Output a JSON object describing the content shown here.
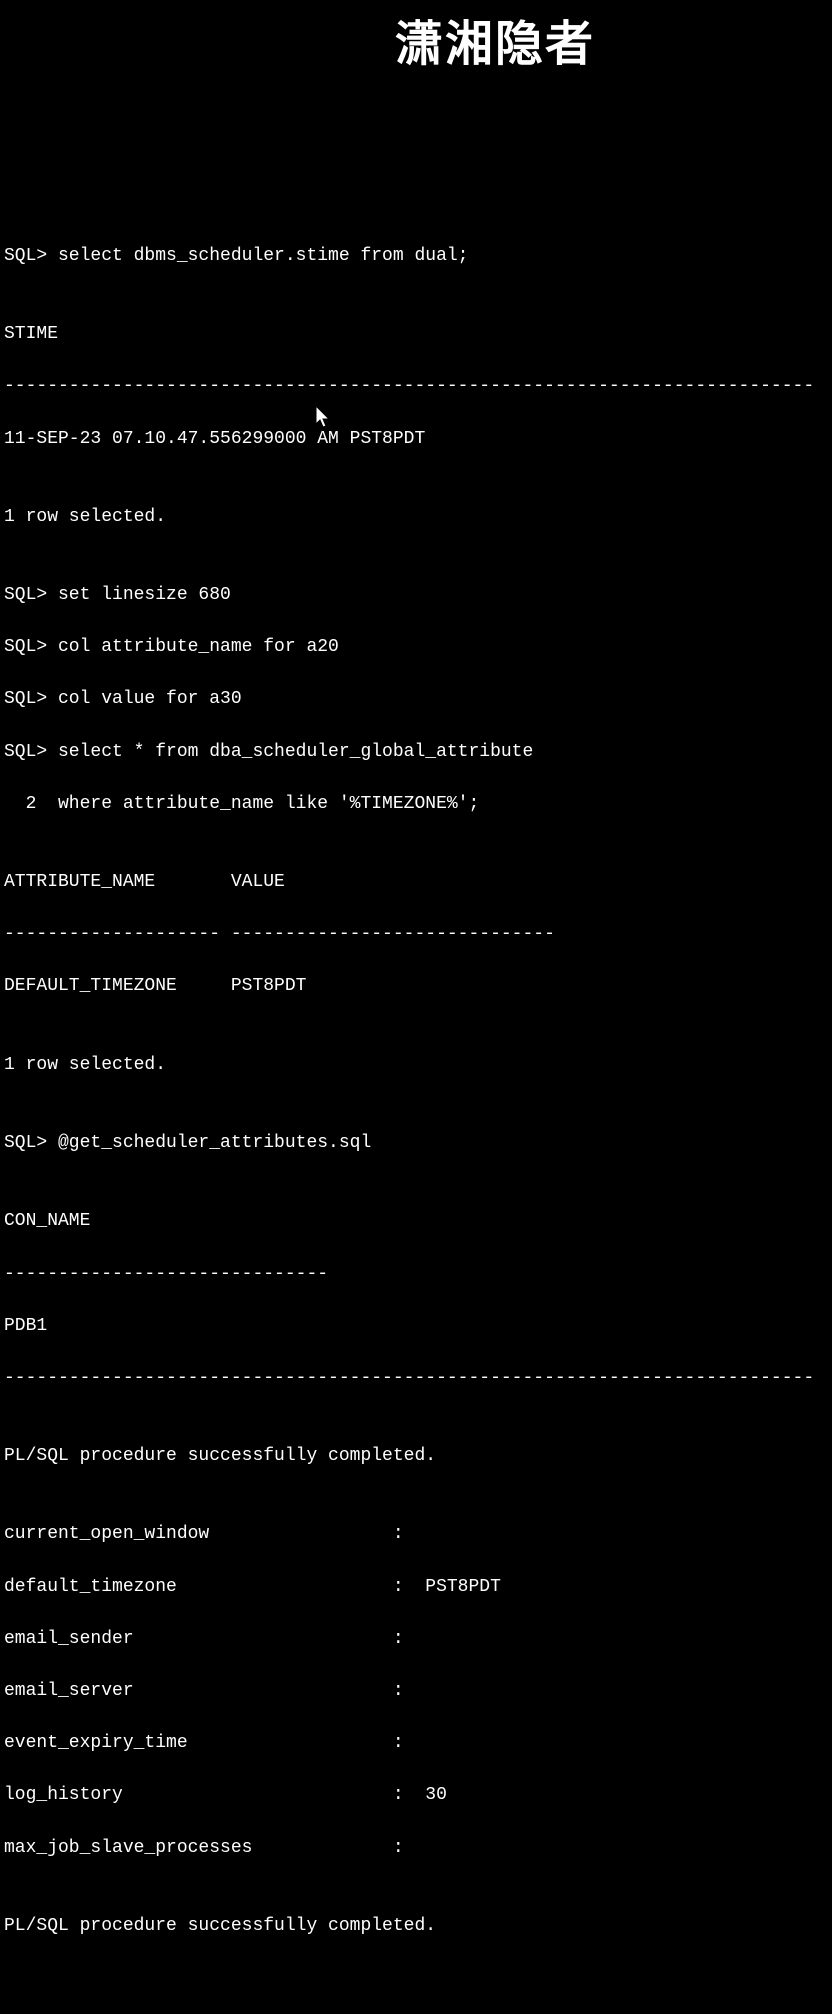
{
  "watermark": "潇湘隐者",
  "lines": {
    "l1": "SQL> select dbms_scheduler.stime from dual;",
    "l2": "",
    "l3": "STIME",
    "l4": "---------------------------------------------------------------------------",
    "l5": "11-SEP-23 07.10.47.556299000 AM PST8PDT",
    "l6": "",
    "l7": "1 row selected.",
    "l8": "",
    "l9": "SQL> set linesize 680",
    "l10": "SQL> col attribute_name for a20",
    "l11": "SQL> col value for a30",
    "l12": "SQL> select * from dba_scheduler_global_attribute",
    "l13": "  2  where attribute_name like '%TIMEZONE%';",
    "l14": "",
    "l15": "ATTRIBUTE_NAME       VALUE",
    "l16": "-------------------- ------------------------------",
    "l17": "DEFAULT_TIMEZONE     PST8PDT",
    "l18": "",
    "l19": "1 row selected.",
    "l20": "",
    "l21": "SQL> @get_scheduler_attributes.sql",
    "l22": "",
    "l23": "CON_NAME",
    "l24": "------------------------------",
    "l25": "PDB1",
    "l26": "---------------------------------------------------------------------------",
    "l27": "",
    "l28": "PL/SQL procedure successfully completed.",
    "l29": "",
    "l30": "current_open_window                 :",
    "l31": "default_timezone                    :  PST8PDT",
    "l32": "email_sender                        :",
    "l33": "email_server                        :",
    "l34": "event_expiry_time                   :",
    "l35": "log_history                         :  30",
    "l36": "max_job_slave_processes             :",
    "l37": "",
    "l38": "PL/SQL procedure successfully completed."
  },
  "cursor_glyph": "➤"
}
